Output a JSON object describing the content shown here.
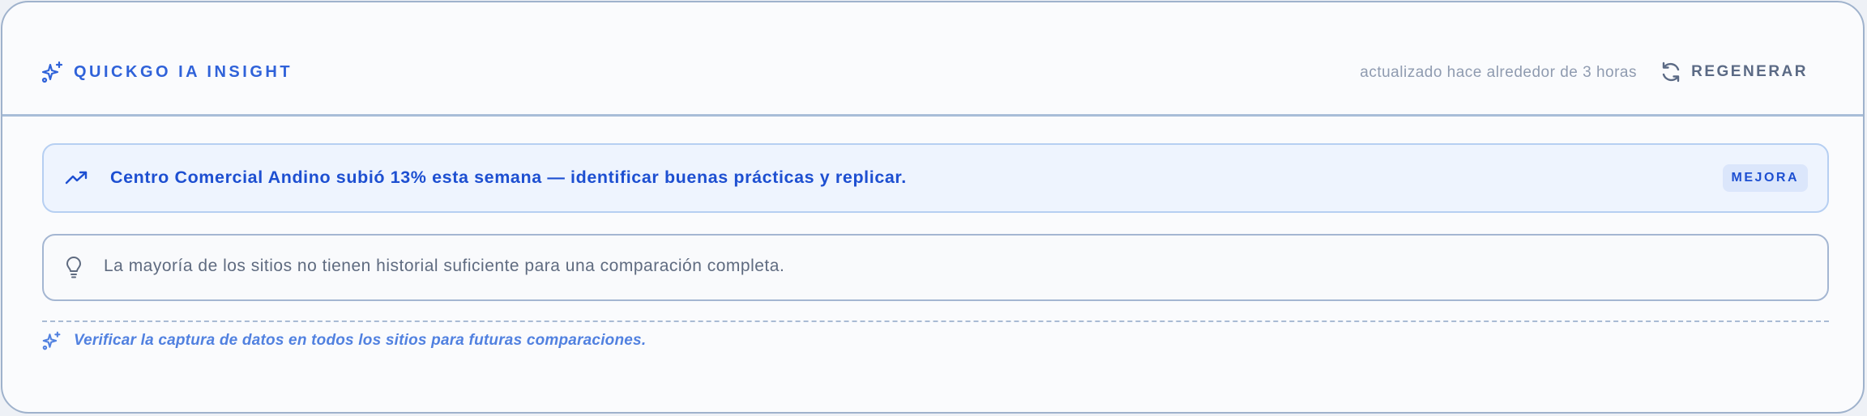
{
  "header": {
    "brand_label": "QUICKGO IA INSIGHT",
    "updated_text": "actualizado hace alrededor de 3 horas",
    "regenerate_label": "REGENERAR"
  },
  "insight": {
    "text": "Centro Comercial Andino subió 13% esta semana — identificar buenas prácticas y replicar.",
    "badge": "MEJORA",
    "icon": "trending-up-icon"
  },
  "note": {
    "text": "La mayoría de los sitios no tienen historial suficiente para una comparación completa.",
    "icon": "lightbulb-icon"
  },
  "footer": {
    "text": "Verificar la captura de datos en todos los sitios para futuras comparaciones.",
    "icon": "sparkles-icon"
  },
  "colors": {
    "accent": "#2f62d9",
    "insight_bg": "#eef4fe",
    "insight_border": "#b6cff2",
    "muted": "#8f9bb0"
  }
}
